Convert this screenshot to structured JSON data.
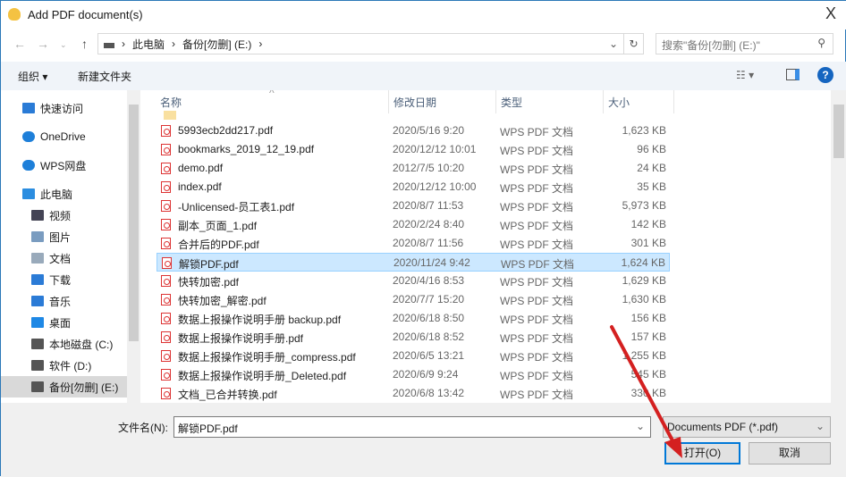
{
  "window": {
    "title": "Add PDF document(s)",
    "close": "X"
  },
  "address": {
    "segments": [
      "此电脑",
      "备份[勿删] (E:)"
    ],
    "search_placeholder": "搜索\"备份[勿删] (E:)\""
  },
  "toolbar": {
    "organize": "组织 ▾",
    "new_folder": "新建文件夹"
  },
  "nav": {
    "items": [
      {
        "label": "快速访问",
        "icon": "star-icon"
      },
      {
        "label": "OneDrive",
        "icon": "cloud-icon"
      },
      {
        "label": "WPS网盘",
        "icon": "cloud-icon"
      },
      {
        "label": "此电脑",
        "icon": "computer-icon"
      },
      {
        "label": "视频",
        "icon": "video-icon"
      },
      {
        "label": "图片",
        "icon": "picture-icon"
      },
      {
        "label": "文档",
        "icon": "document-icon"
      },
      {
        "label": "下载",
        "icon": "download-icon"
      },
      {
        "label": "音乐",
        "icon": "music-icon"
      },
      {
        "label": "桌面",
        "icon": "desktop-icon"
      },
      {
        "label": "本地磁盘 (C:)",
        "icon": "drive-icon"
      },
      {
        "label": "软件 (D:)",
        "icon": "drive-icon"
      },
      {
        "label": "备份[勿删] (E:)",
        "icon": "drive-icon"
      }
    ]
  },
  "columns": {
    "name": "名称",
    "date": "修改日期",
    "type": "类型",
    "size": "大小"
  },
  "files": [
    {
      "name": "5993ecb2dd217.pdf",
      "date": "2020/5/16 9:20",
      "type": "WPS PDF 文档",
      "size": "1,623 KB"
    },
    {
      "name": "bookmarks_2019_12_19.pdf",
      "date": "2020/12/12 10:01",
      "type": "WPS PDF 文档",
      "size": "96 KB"
    },
    {
      "name": "demo.pdf",
      "date": "2012/7/5 10:20",
      "type": "WPS PDF 文档",
      "size": "24 KB"
    },
    {
      "name": "index.pdf",
      "date": "2020/12/12 10:00",
      "type": "WPS PDF 文档",
      "size": "35 KB"
    },
    {
      "name": "-Unlicensed-员工表1.pdf",
      "date": "2020/8/7 11:53",
      "type": "WPS PDF 文档",
      "size": "5,973 KB"
    },
    {
      "name": "副本_页面_1.pdf",
      "date": "2020/2/24 8:40",
      "type": "WPS PDF 文档",
      "size": "142 KB"
    },
    {
      "name": "合并后的PDF.pdf",
      "date": "2020/8/7 11:56",
      "type": "WPS PDF 文档",
      "size": "301 KB"
    },
    {
      "name": "解锁PDF.pdf",
      "date": "2020/11/24 9:42",
      "type": "WPS PDF 文档",
      "size": "1,624 KB"
    },
    {
      "name": "快转加密.pdf",
      "date": "2020/4/16 8:53",
      "type": "WPS PDF 文档",
      "size": "1,629 KB"
    },
    {
      "name": "快转加密_解密.pdf",
      "date": "2020/7/7 15:20",
      "type": "WPS PDF 文档",
      "size": "1,630 KB"
    },
    {
      "name": "数据上报操作说明手册 backup.pdf",
      "date": "2020/6/18 8:50",
      "type": "WPS PDF 文档",
      "size": "156 KB"
    },
    {
      "name": "数据上报操作说明手册.pdf",
      "date": "2020/6/18 8:52",
      "type": "WPS PDF 文档",
      "size": "157 KB"
    },
    {
      "name": "数据上报操作说明手册_compress.pdf",
      "date": "2020/6/5 13:21",
      "type": "WPS PDF 文档",
      "size": "1,255 KB"
    },
    {
      "name": "数据上报操作说明手册_Deleted.pdf",
      "date": "2020/6/9 9:24",
      "type": "WPS PDF 文档",
      "size": "545 KB"
    },
    {
      "name": "文档_已合并转换.pdf",
      "date": "2020/6/8 13:42",
      "type": "WPS PDF 文档",
      "size": "330 KB"
    }
  ],
  "selected_index": 7,
  "bottom": {
    "filename_label": "文件名(N):",
    "filename_value": "解锁PDF.pdf",
    "filetype": "Documents PDF (*.pdf)",
    "open": "打开(O)",
    "cancel": "取消"
  },
  "colors": {
    "accent": "#0078d7",
    "selection": "#cce8ff",
    "arrow": "#d42020"
  }
}
